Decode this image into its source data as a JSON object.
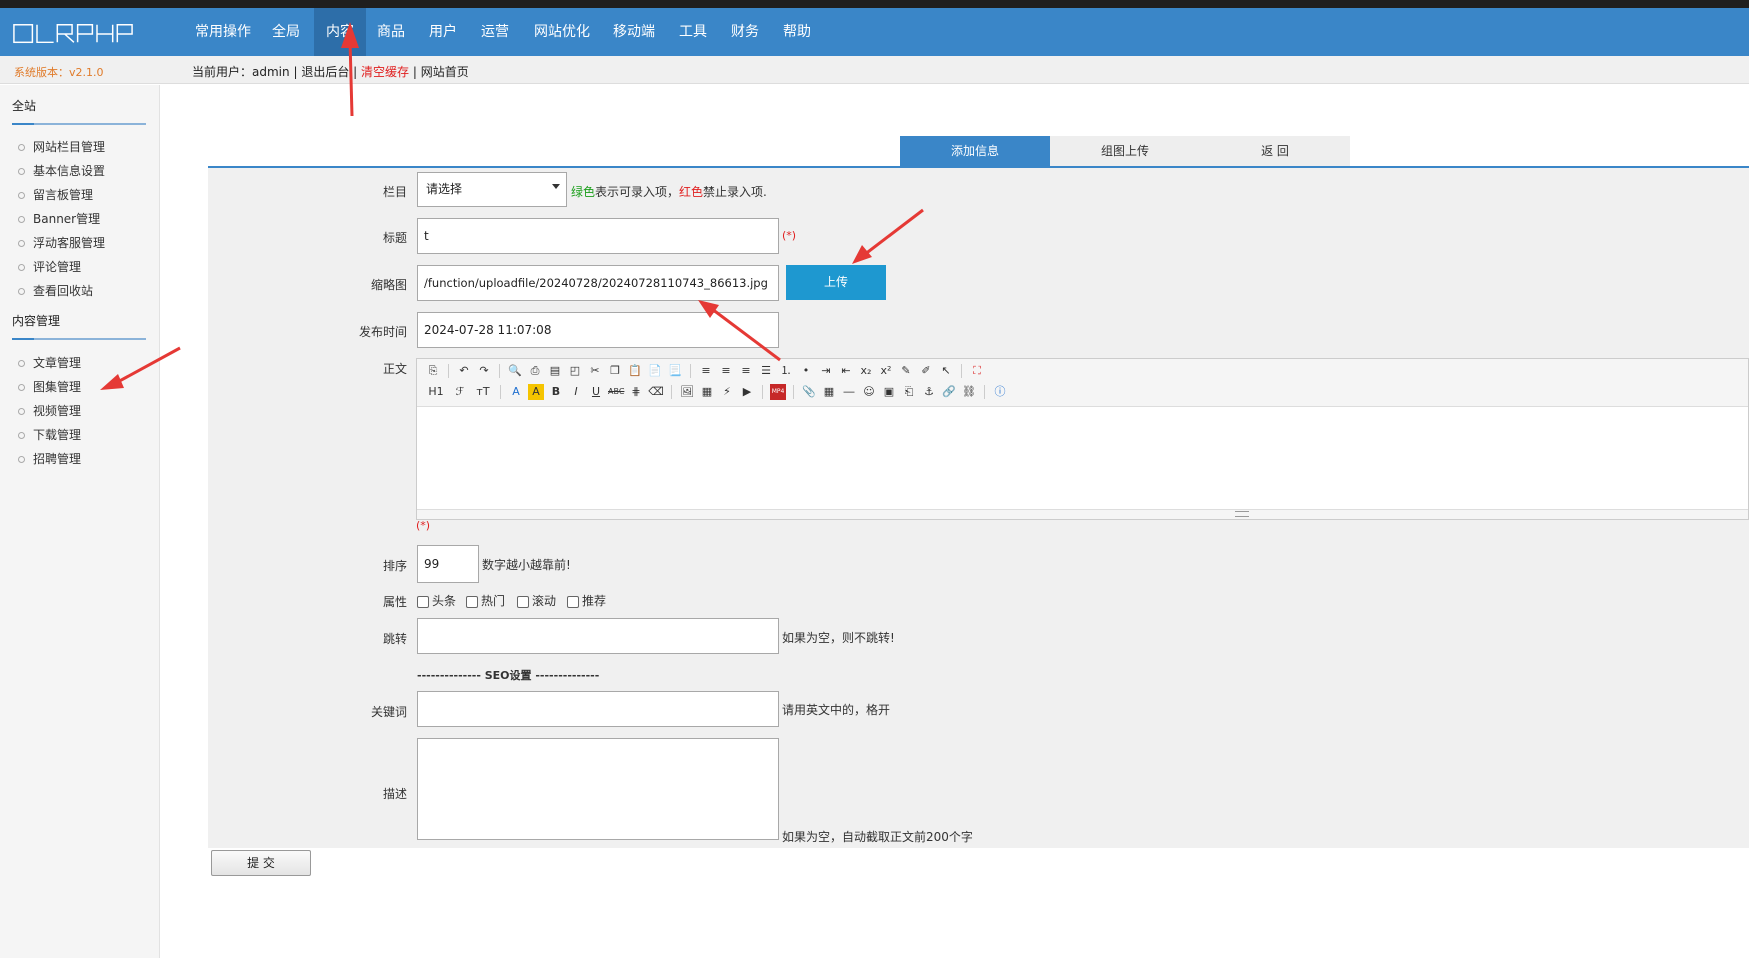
{
  "brand": {
    "logo_text": "OLRPHP"
  },
  "nav": {
    "items": [
      "常用操作",
      "全局",
      "内容",
      "商品",
      "用户",
      "运营",
      "网站优化",
      "移动端",
      "工具",
      "财务",
      "帮助"
    ],
    "active": "内容"
  },
  "infobar": {
    "version": "系统版本：v2.1.0",
    "current_user_label": "当前用户：admin",
    "logout": "退出后台",
    "clear_cache": "清空缓存",
    "site_home": "网站首页",
    "sep": "|"
  },
  "sidebar": {
    "group1": "全站",
    "group1_items": [
      "网站栏目管理",
      "基本信息设置",
      "留言板管理",
      "Banner管理",
      "浮动客服管理",
      "评论管理",
      "查看回收站"
    ],
    "group2": "内容管理",
    "group2_items": [
      "文章管理",
      "图集管理",
      "视频管理",
      "下载管理",
      "招聘管理"
    ]
  },
  "tabs": [
    "添加信息",
    "组图上传",
    "返 回"
  ],
  "form": {
    "column_label": "栏目",
    "column_value": "请选择",
    "column_hint_green": "绿色",
    "column_hint_mid": "表示可录入项，",
    "column_hint_red": "红色",
    "column_hint_end": "禁止录入项.",
    "title_label": "标题",
    "title_value": "t",
    "required_mark": "(*)",
    "thumb_label": "缩略图",
    "thumb_value": "/function/uploadfile/20240728/20240728110743_86613.jpg",
    "upload_btn": "上传",
    "date_label": "发布时间",
    "date_value": "2024-07-28 11:07:08",
    "body_label": "正文",
    "sort_label": "排序",
    "sort_value": "99",
    "sort_hint": "数字越小越靠前!",
    "attr_label": "属性",
    "attrs": [
      "头条",
      "热门",
      "滚动",
      "推荐"
    ],
    "jump_label": "跳转",
    "jump_hint": "如果为空，则不跳转!",
    "seo_heading": "-------------- SEO设置 --------------",
    "keywords_label": "关键词",
    "keywords_hint": "请用英文中的，格开",
    "desc_label": "描述",
    "desc_hint": "如果为空，自动截取正文前200个字",
    "submit": "提 交"
  },
  "editor_toolbar": {
    "row2_items": [
      "H1",
      "ℱ",
      "тT",
      "A",
      "A",
      "B",
      "I",
      "U",
      "ABC"
    ]
  },
  "colors": {
    "nav_bg": "#3a86c8",
    "upload_btn": "#1e98d0",
    "annotation_arrow": "#e53935"
  }
}
